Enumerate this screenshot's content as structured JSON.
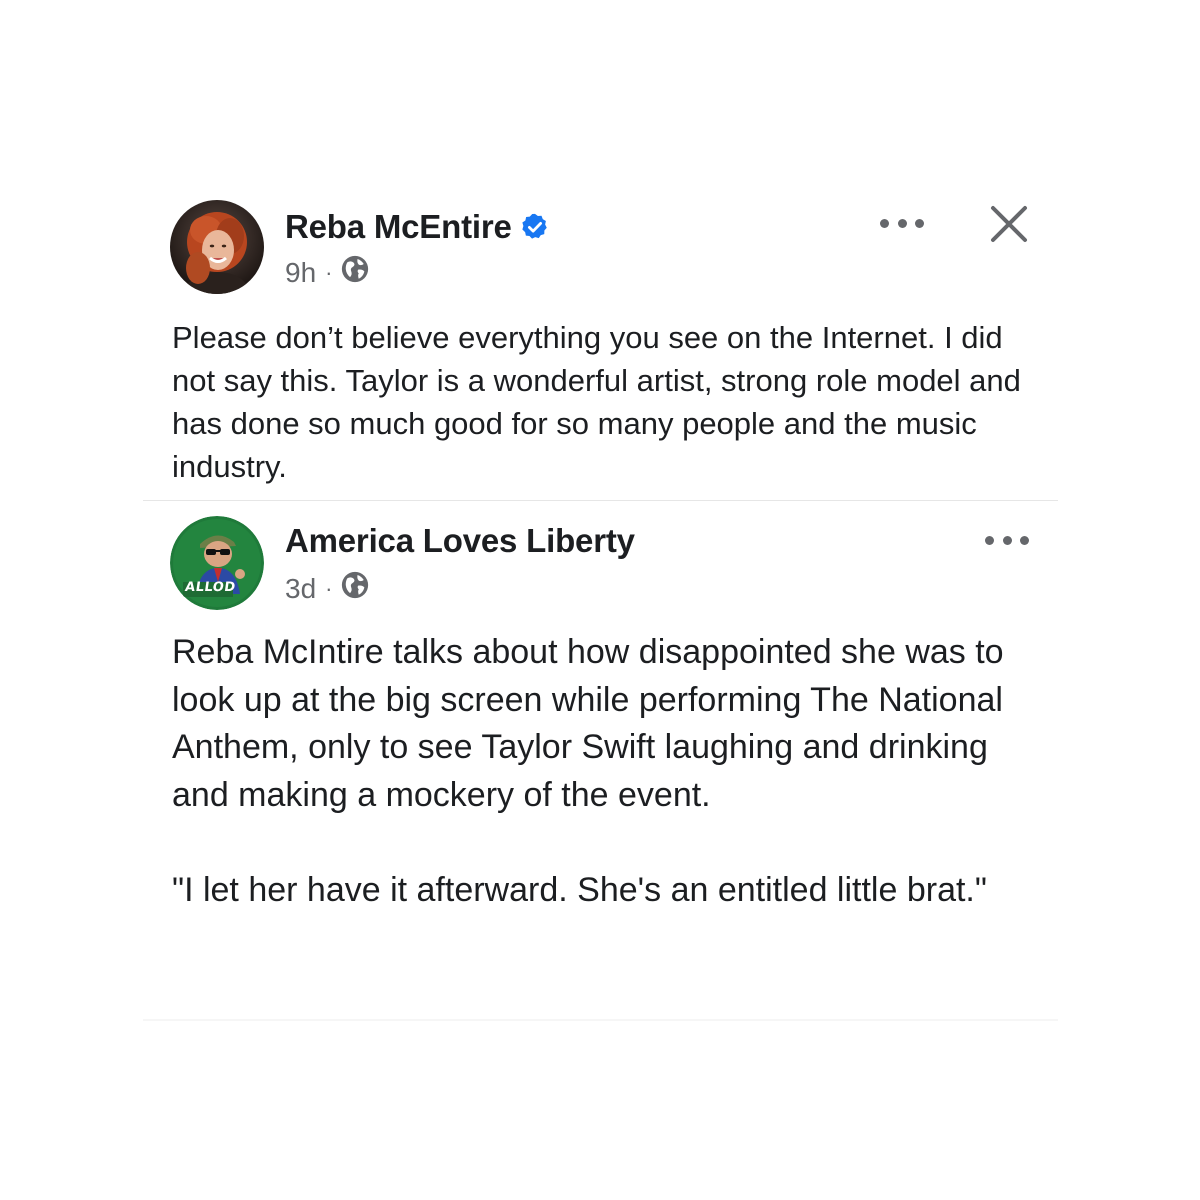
{
  "posts": [
    {
      "author": "Reba McEntire",
      "verified": true,
      "time": "9h",
      "separator": "·",
      "audience_icon": "globe-icon",
      "body": "Please don’t believe everything you see on the Internet. I did not say this. Taylor is a wonderful artist, strong role model and has done so much good for so many people and the music industry.",
      "actions": [
        "more-options-icon",
        "close-icon"
      ]
    },
    {
      "author": "America Loves Liberty",
      "verified": false,
      "avatar_text": "ALLOD",
      "time": "3d",
      "separator": "·",
      "audience_icon": "globe-icon",
      "body": "Reba McIntire talks about how disappointed she was to look up at the big screen while performing The National Anthem, only to see Taylor Swift laughing and drinking and making a mockery of the event.\n\n\"I let her have it afterward. She's an entitled little brat.\"",
      "actions": [
        "more-options-icon"
      ]
    }
  ],
  "colors": {
    "verified_badge": "#1877f2",
    "secondary_text": "#65676b",
    "primary_text": "#1c1e21",
    "avatar_2_background": "#1f7a3a"
  }
}
